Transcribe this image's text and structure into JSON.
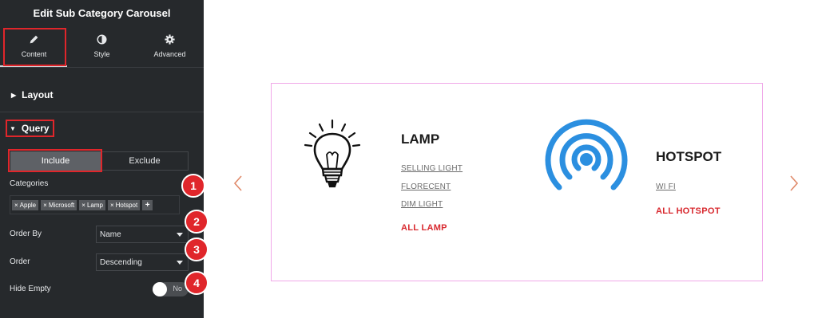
{
  "sidebar": {
    "title": "Edit Sub Category Carousel",
    "tabs": [
      {
        "label": "Content",
        "icon": "pencil-icon"
      },
      {
        "label": "Style",
        "icon": "half-circle-icon"
      },
      {
        "label": "Advanced",
        "icon": "gear-icon"
      }
    ],
    "sections": {
      "layout": "Layout",
      "query": "Query"
    },
    "query": {
      "include": "Include",
      "exclude": "Exclude",
      "categories_label": "Categories",
      "categories": [
        "Apple",
        "Microsoft",
        "Lamp",
        "Hotspot"
      ],
      "order_by_label": "Order By",
      "order_by_value": "Name",
      "order_label": "Order",
      "order_value": "Descending",
      "hide_empty_label": "Hide Empty",
      "hide_empty_value": "No"
    },
    "badges": [
      "1",
      "2",
      "3",
      "4"
    ],
    "highlight_color": "#e0262b"
  },
  "preview": {
    "cards": [
      {
        "title": "LAMP",
        "icon": "lightbulb-icon",
        "links": [
          "SELLING LIGHT",
          "FLORECENT",
          "DIM LIGHT"
        ],
        "all_link": "ALL LAMP"
      },
      {
        "title": "HOTSPOT",
        "icon": "hotspot-icon",
        "links": [
          "WI FI"
        ],
        "all_link": "ALL HOTSPOT"
      }
    ],
    "accent_color": "#d8282e",
    "hotspot_color": "#2b8fe0",
    "arrow_color": "#e08a6a"
  }
}
